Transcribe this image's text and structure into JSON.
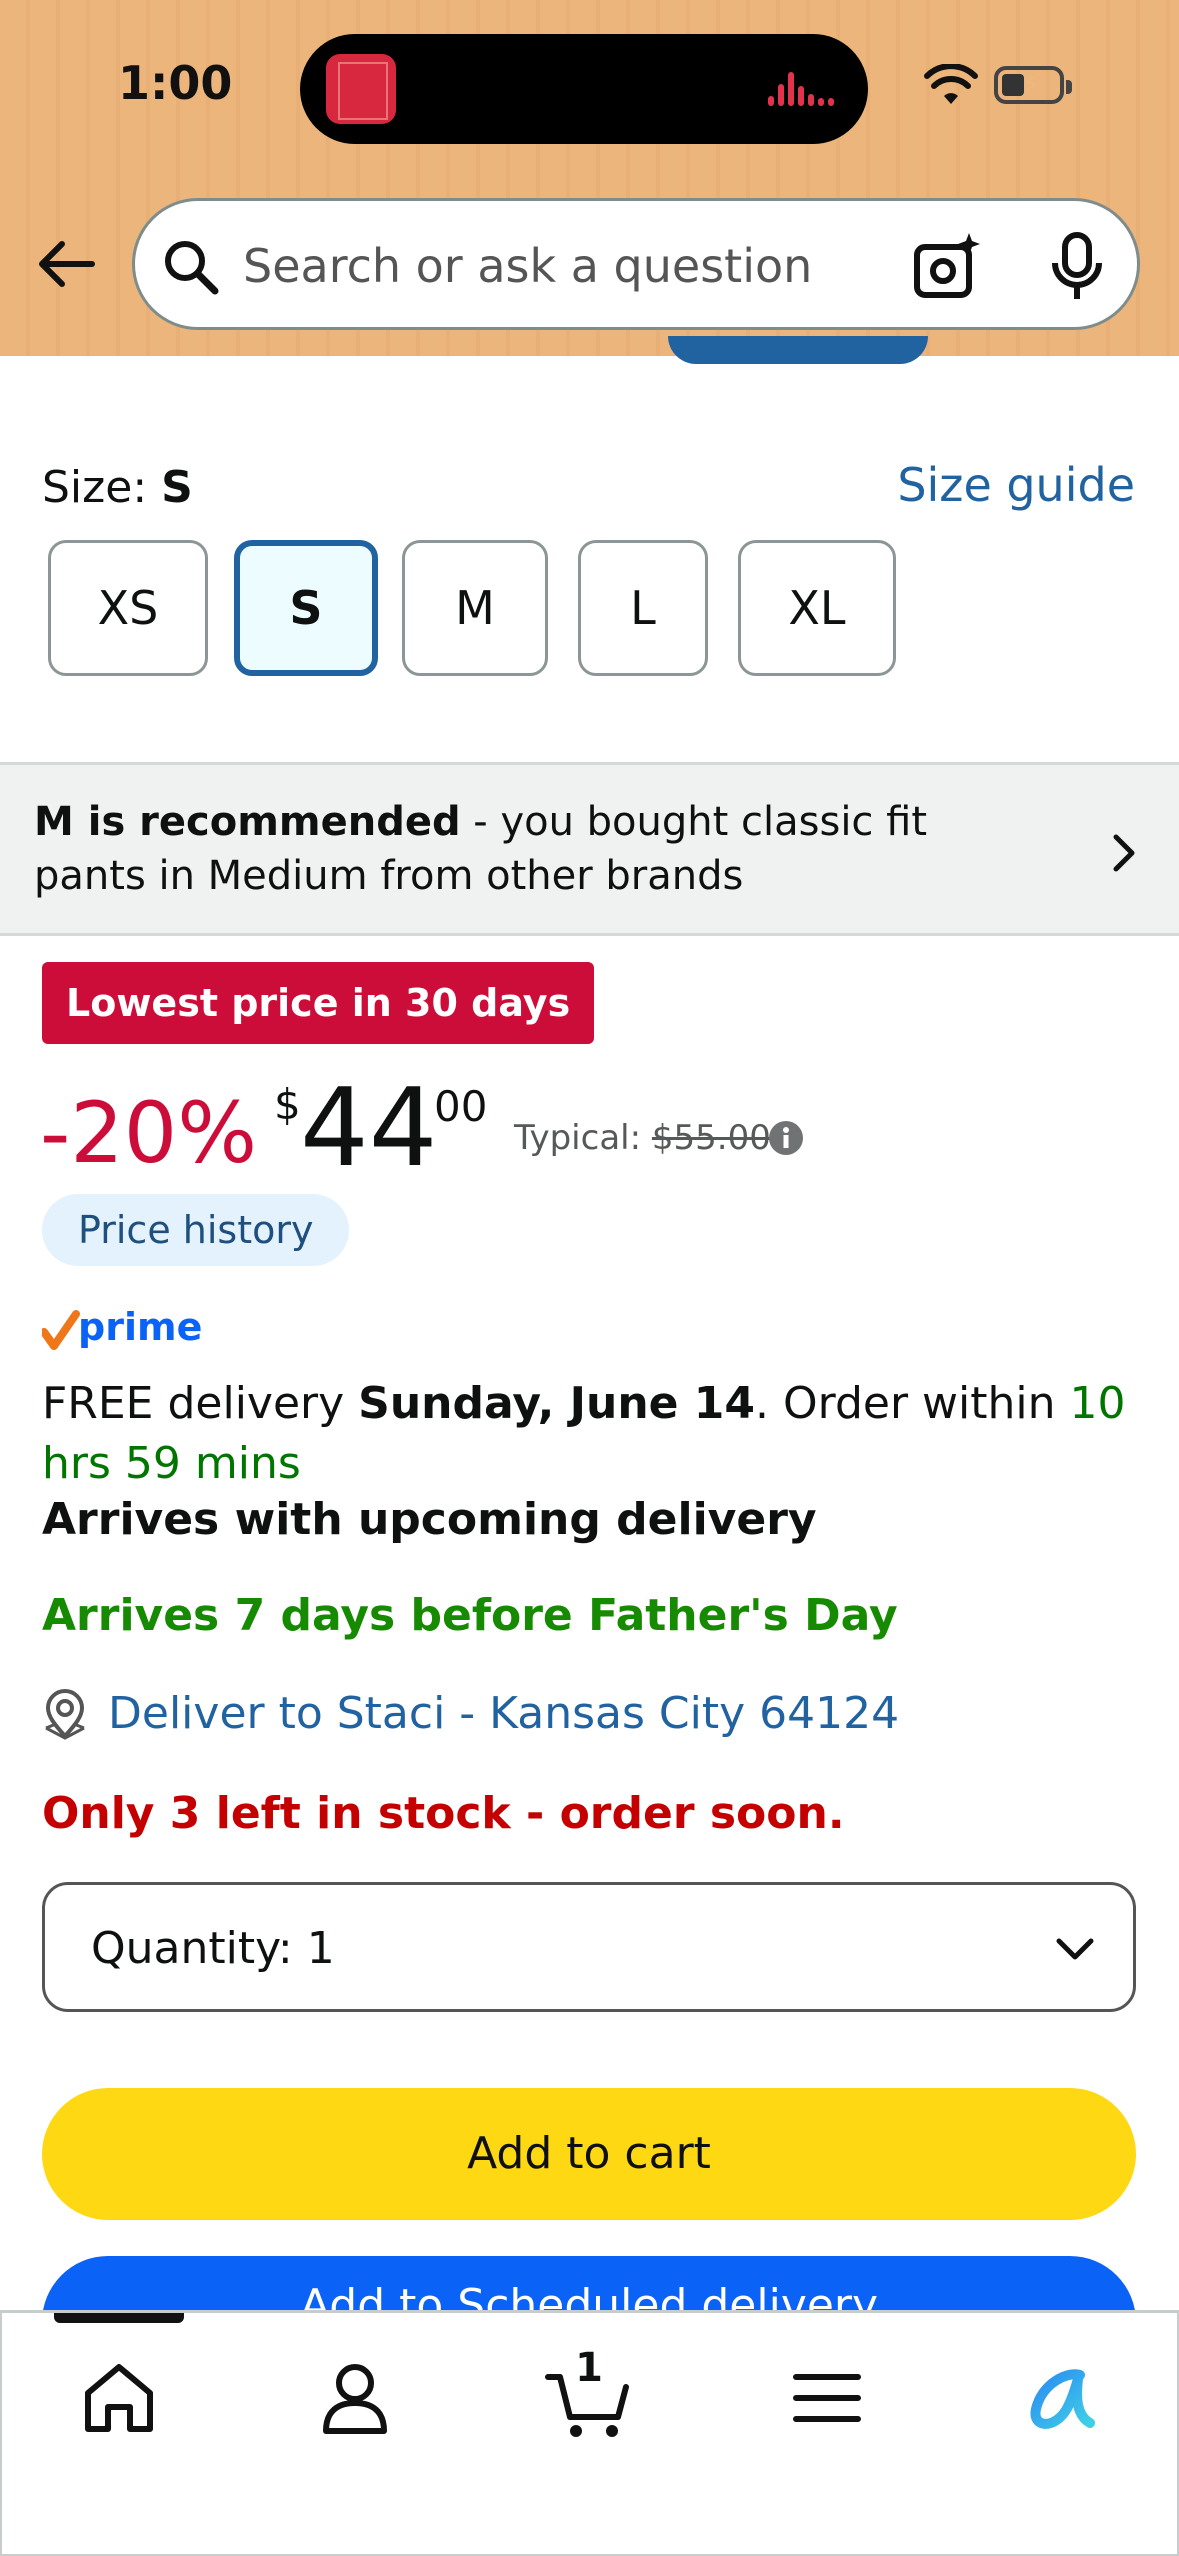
{
  "status_bar": {
    "time": "1:00"
  },
  "search": {
    "placeholder": "Search or ask a question"
  },
  "size": {
    "label": "Size: ",
    "selected": "S",
    "guide_link": "Size guide",
    "options": [
      "XS",
      "S",
      "M",
      "L",
      "XL"
    ]
  },
  "recommendation": {
    "bold": "M is recommended",
    "rest": " - you bought classic fit pants in Medium from other brands"
  },
  "price": {
    "badge": "Lowest price in 30 days",
    "discount": "-20%",
    "symbol": "$",
    "whole": "44",
    "fraction": "00",
    "typical_label": "Typical: ",
    "typical_value": "$55.00",
    "history_button": "Price history"
  },
  "prime": {
    "logo_text": "prime"
  },
  "delivery": {
    "prefix": "FREE delivery ",
    "date": "Sunday, June 14",
    "middle": ". Order within ",
    "countdown": "10 hrs 59 mins",
    "upcoming": "Arrives with upcoming delivery",
    "fathers_day": "Arrives 7 days before Father's Day",
    "deliver_to": "Deliver to Staci - Kansas City 64124"
  },
  "stock": "Only 3 left in stock - order soon.",
  "quantity": {
    "label": "Quantity: ",
    "value": "1"
  },
  "buttons": {
    "add_to_cart": "Add to cart",
    "add_to_next": "Add to Scheduled delivery"
  },
  "nav": {
    "cart_count": "1"
  },
  "colors": {
    "header_bg": "#ebb57c",
    "link_blue": "#2162a1",
    "deal_red": "#cc0c39",
    "add_to_cart_yellow": "#ffd814",
    "blue_button": "#0b62f7",
    "green": "#007600"
  }
}
